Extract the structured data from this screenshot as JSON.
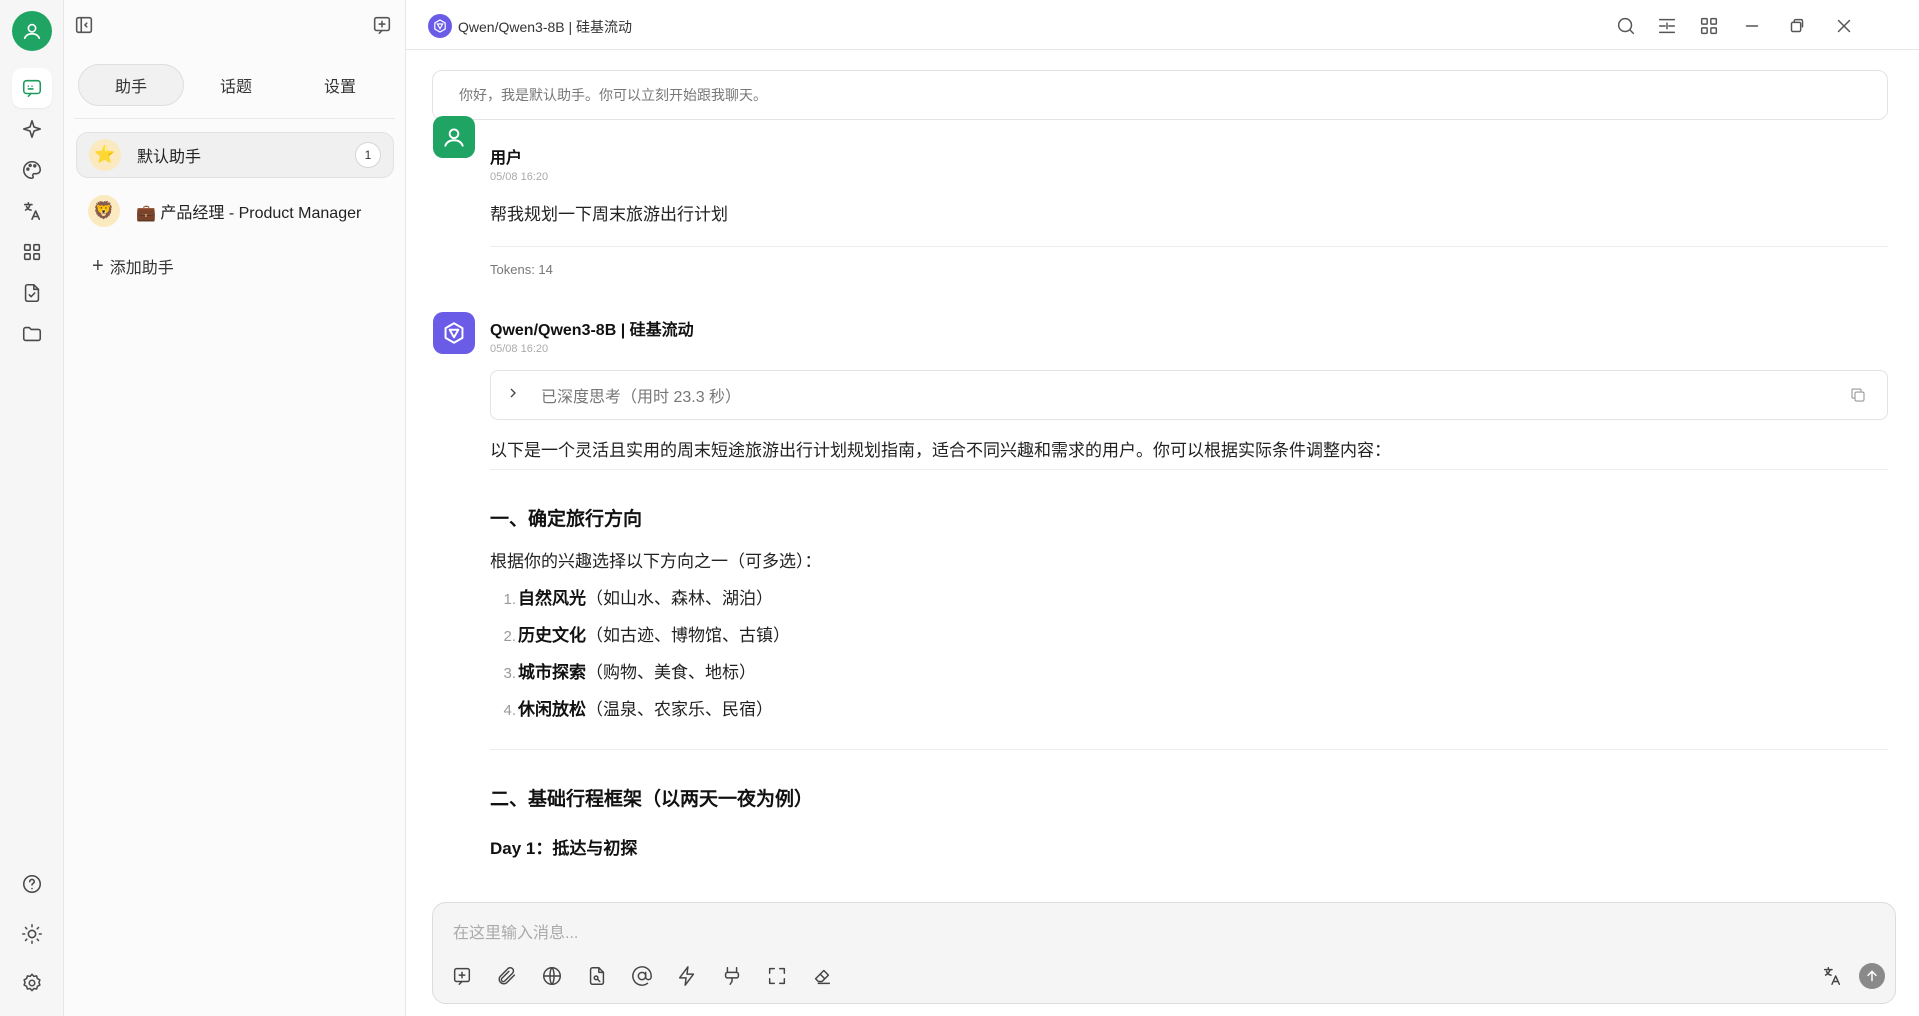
{
  "colors": {
    "accent": "#1fa463",
    "model_logo": "#6b5ce7",
    "assistant_avatar": "#6b5ce7"
  },
  "header": {
    "title": "Qwen/Qwen3-8B | 硅基流动"
  },
  "sidebar": {
    "tabs": [
      {
        "label": "助手",
        "active": true
      },
      {
        "label": "话题",
        "active": false
      },
      {
        "label": "设置",
        "active": false
      }
    ],
    "assistants": [
      {
        "emoji": "⭐",
        "name": "默认助手",
        "badge": "1",
        "active": true
      },
      {
        "emoji": "🦁",
        "name": "💼 产品经理 - Product Manager",
        "badge": "",
        "active": false
      }
    ],
    "add_label": "添加助手"
  },
  "chat": {
    "welcome": "你好，我是默认助手。你可以立刻开始跟我聊天。",
    "user_message": {
      "sender": "用户",
      "time": "05/08 16:20",
      "text": "帮我规划一下周末旅游出行计划",
      "tokens": "Tokens: 14"
    },
    "assistant_message": {
      "sender": "Qwen/Qwen3-8B | 硅基流动",
      "time": "05/08 16:20",
      "thinking": "已深度思考（用时 23.3 秒）",
      "intro": "以下是一个灵活且实用的周末短途旅游出行计划规划指南，适合不同兴趣和需求的用户。你可以根据实际条件调整内容：",
      "section1_title": "一、确定旅行方向",
      "section1_text": "根据你的兴趣选择以下方向之一（可多选）：",
      "list": [
        {
          "num": "1.",
          "bold": "自然风光",
          "rest": "（如山水、森林、湖泊）"
        },
        {
          "num": "2.",
          "bold": "历史文化",
          "rest": "（如古迹、博物馆、古镇）"
        },
        {
          "num": "3.",
          "bold": "城市探索",
          "rest": "（购物、美食、地标）"
        },
        {
          "num": "4.",
          "bold": "休闲放松",
          "rest": "（温泉、农家乐、民宿）"
        }
      ],
      "section2_title": "二、基础行程框架（以两天一夜为例）",
      "day1_title": "Day 1：抵达与初探"
    }
  },
  "composer": {
    "placeholder": "在这里输入消息..."
  },
  "icons": {
    "rail": [
      "user-avatar-icon",
      "chat-icon",
      "sparkle-icon",
      "palette-icon",
      "translate-icon",
      "apps-grid-icon",
      "document-icon",
      "folder-icon",
      "help-icon",
      "theme-sun-icon",
      "settings-gear-icon"
    ],
    "header": [
      "search-icon",
      "minimize-panel-icon",
      "layout-grid-icon",
      "window-minimize-icon",
      "window-restore-icon",
      "window-close-icon"
    ],
    "composer": [
      "new-topic-icon",
      "attachment-icon",
      "web-search-icon",
      "knowledge-base-icon",
      "mention-icon",
      "quick-phrase-icon",
      "mcp-icon",
      "fullscreen-icon",
      "clear-icon",
      "translate-icon",
      "send-icon"
    ]
  }
}
